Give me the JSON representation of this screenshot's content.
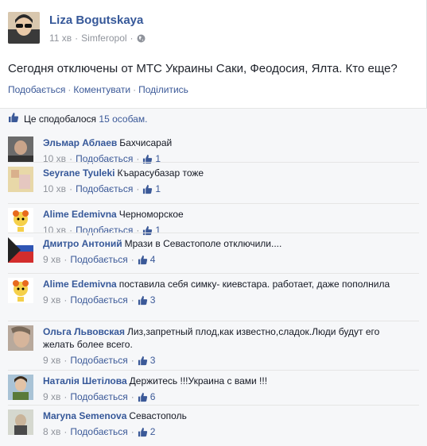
{
  "post": {
    "author": "Liza Bogutskaya",
    "time": "11 хв",
    "location": "Simferopol",
    "privacy_icon": "globe-icon",
    "text": "Сегодня отключены от МТС Украины Саки, Феодосия, Ялта. Кто еще?",
    "actions": {
      "like": "Подобається",
      "comment": "Коментувати",
      "share": "Поділитись"
    }
  },
  "likes_bar": {
    "text_prefix": "Це сподобалося",
    "count_link": "15 особам."
  },
  "colors": {
    "link": "#3b5998",
    "name": "#365899",
    "muted": "#90949c"
  },
  "comments": [
    {
      "name": "Эльмар Аблаев",
      "text": "Бахчисарай",
      "time": "10 хв",
      "like": "Подобається",
      "likes": "1"
    },
    {
      "name": "Seyrane Tyuleki",
      "text": "Къарасубазар тоже",
      "time": "10 хв",
      "like": "Подобається",
      "likes": "1"
    },
    {
      "name": "Alime Edemivna",
      "text": "Черноморское",
      "time": "10 хв",
      "like": "Подобається",
      "likes": "1"
    },
    {
      "name": "Дмитро Антоний",
      "text": "Мрази в Севастополе отключили....",
      "time": "9 хв",
      "like": "Подобається",
      "likes": "4"
    },
    {
      "name": "Alime Edemivna",
      "text": "поставила себя симку- киевстара. работает, даже пополнила",
      "time": "9 хв",
      "like": "Подобається",
      "likes": "3"
    },
    {
      "name": "Ольга Львовская",
      "text": "Лиз,запретный плод,как известно,сладок.Люди будут его желать более всего.",
      "time": "9 хв",
      "like": "Подобається",
      "likes": "3"
    },
    {
      "name": "Наталія Шетілова",
      "text": "Держитесь !!!Украина с вами !!!",
      "time": "9 хв",
      "like": "Подобається",
      "likes": "6"
    },
    {
      "name": "Maryna Semenova",
      "text": "Севастополь",
      "time": "8 хв",
      "like": "Подобається",
      "likes": "2"
    }
  ]
}
